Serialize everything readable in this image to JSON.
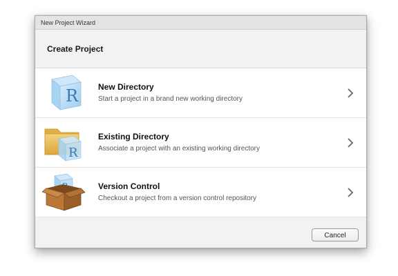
{
  "window": {
    "title": "New Project Wizard"
  },
  "header": {
    "title": "Create Project"
  },
  "options": [
    {
      "title": "New Directory",
      "description": "Start a project in a brand new working directory",
      "icon": "r-cube-icon"
    },
    {
      "title": "Existing Directory",
      "description": "Associate a project with an existing working directory",
      "icon": "folder-r-cube-icon"
    },
    {
      "title": "Version Control",
      "description": "Checkout a project from a version control repository",
      "icon": "cardboard-box-icon"
    }
  ],
  "footer": {
    "cancel_label": "Cancel"
  },
  "colors": {
    "r_blue": "#3a78b8",
    "folder_yellow": "#e8b84a",
    "box_brown": "#a86a2e"
  }
}
